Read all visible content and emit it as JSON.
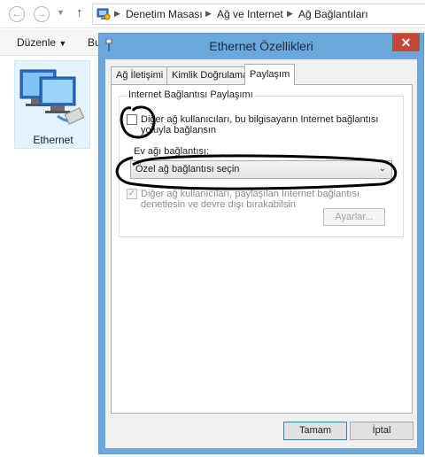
{
  "explorer": {
    "back_icon": "back-arrow-icon",
    "forward_icon": "forward-arrow-icon",
    "up_icon": "up-arrow-icon",
    "breadcrumbs": [
      "Denetim Masası",
      "Ağ ve Internet",
      "Ağ Bağlantıları"
    ],
    "toolbar": {
      "organize": "Düzenle",
      "partial": "Bu"
    },
    "item": {
      "label": "Ethernet",
      "icon": "network-adapter-icon"
    }
  },
  "dialog": {
    "title": "Ethernet Özellikleri",
    "close_label": "✕",
    "tabs": [
      "Ağ İletişimi",
      "Kimlik Doğrulama",
      "Paylaşım"
    ],
    "active_tab": "Paylaşım",
    "group_title": "Internet Bağlantısı Paylaşımı",
    "share_checkbox": {
      "line1": "Diğer ağ kullanıcıları, bu bilgisayarın Internet bağlantısı",
      "line2": "yoluyla bağlansın",
      "checked": false
    },
    "home_label": "Ev ağı bağlantısı:",
    "home_select": {
      "value": "Özel ağ bağlantısı seçin"
    },
    "control_checkbox": {
      "line1": "Diğer ağ kullanıcıları, paylaşılan Internet bağlantısı",
      "line2": "denetlesin ve devre dışı bırakabilsin",
      "checked": true,
      "enabled": false
    },
    "settings_button": "Ayarlar...",
    "ok_button": "Tamam",
    "cancel_button": "İptal"
  },
  "colors": {
    "title_bar": "#6ba7dd",
    "close_button": "#c7463c",
    "annotation": "#000000"
  }
}
